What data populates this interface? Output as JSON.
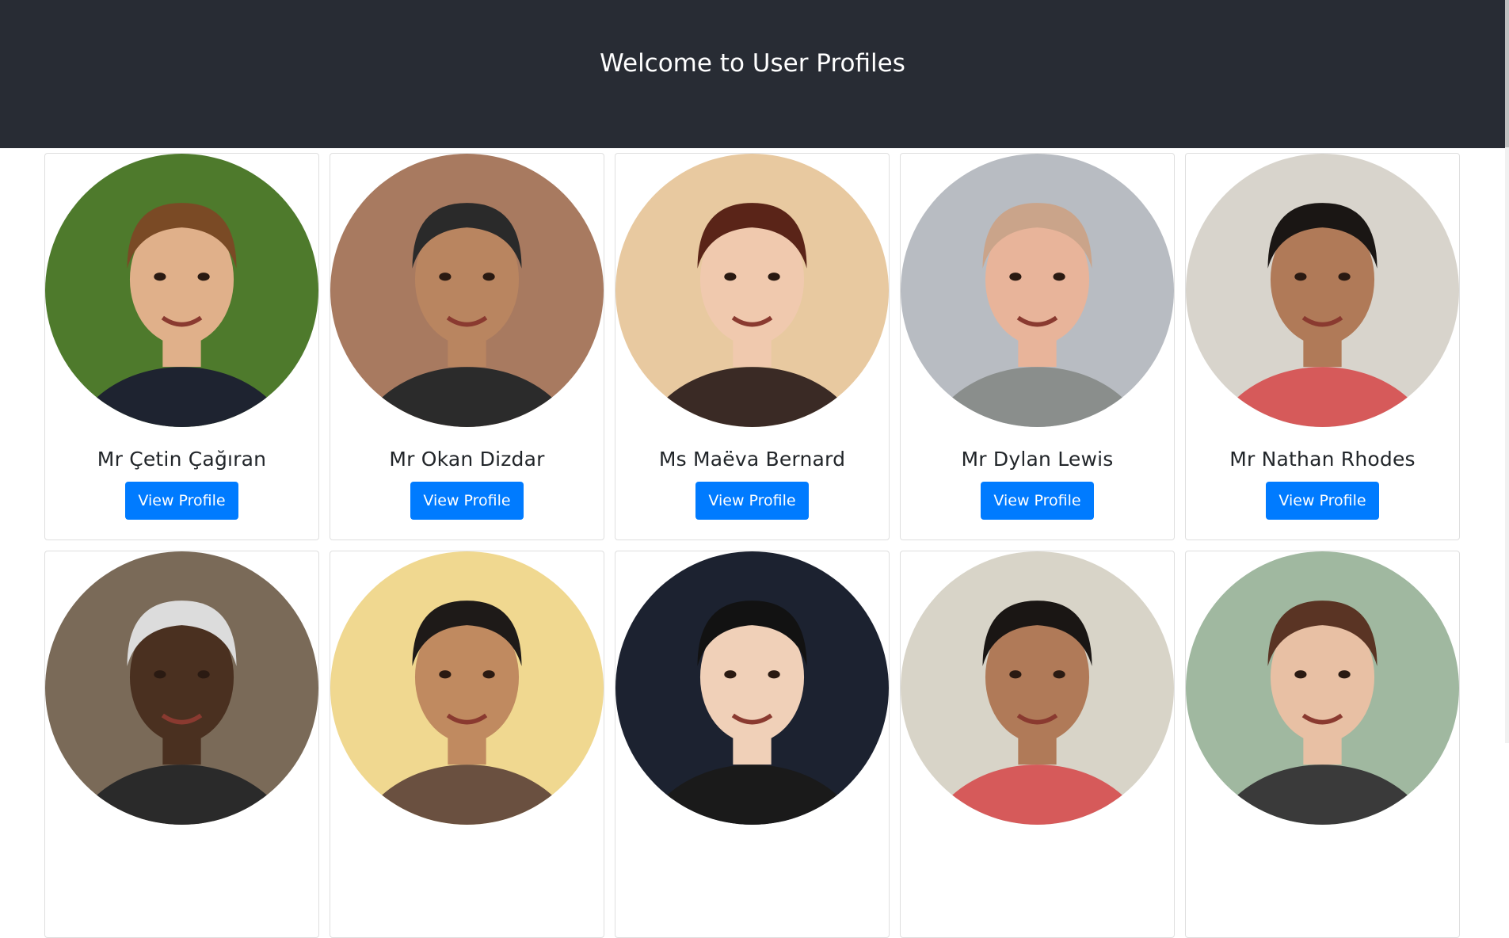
{
  "header": {
    "title": "Welcome to User Profiles"
  },
  "button_label": "View Profile",
  "profiles": [
    {
      "name": "Mr Çetin Çağıran",
      "bg": "#4e7a2c",
      "skin": "#e0b08a",
      "hair": "#7a4a25",
      "shirt": "#1e2330"
    },
    {
      "name": "Mr Okan Dizdar",
      "bg": "#a87a60",
      "skin": "#b98560",
      "hair": "#2a2a2a",
      "shirt": "#2b2b2b"
    },
    {
      "name": "Ms Maëva Bernard",
      "bg": "#e8c9a0",
      "skin": "#f0c9ae",
      "hair": "#5a2418",
      "shirt": "#3a2a25"
    },
    {
      "name": "Mr Dylan Lewis",
      "bg": "#b8bcc2",
      "skin": "#e8b49a",
      "hair": "#caa48a",
      "shirt": "#8a8e8c"
    },
    {
      "name": "Mr Nathan Rhodes",
      "bg": "#d8d4cc",
      "skin": "#b07a58",
      "hair": "#1a1614",
      "shirt": "#d65a5a"
    },
    {
      "name": "",
      "bg": "#7a6a58",
      "skin": "#4a3020",
      "hair": "#dcdcdc",
      "shirt": "#2a2a2a"
    },
    {
      "name": "",
      "bg": "#f0d890",
      "skin": "#c08a60",
      "hair": "#1e1a18",
      "shirt": "#6a5040"
    },
    {
      "name": "",
      "bg": "#1c2230",
      "skin": "#f0d0b8",
      "hair": "#121212",
      "shirt": "#1a1a1a"
    },
    {
      "name": "",
      "bg": "#d8d4c8",
      "skin": "#b07a58",
      "hair": "#1a1614",
      "shirt": "#d65a5a"
    },
    {
      "name": "",
      "bg": "#a0b8a0",
      "skin": "#e8c0a4",
      "hair": "#5a3424",
      "shirt": "#3a3a3a"
    }
  ]
}
